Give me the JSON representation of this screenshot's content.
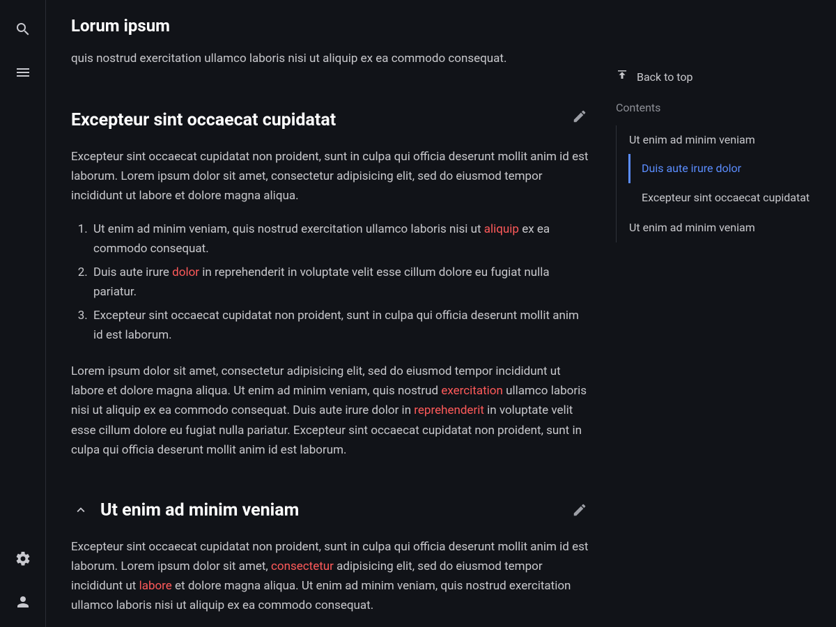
{
  "page": {
    "title": "Lorum ipsum"
  },
  "rail": {
    "search": "Search",
    "menu": "Menu",
    "settings": "Settings",
    "account": "Account"
  },
  "toc": {
    "back": "Back to top",
    "contents": "Contents",
    "items": [
      {
        "label": "Ut enim ad minim veniam",
        "children": [
          {
            "label": "Duis aute irure dolor",
            "active": true
          },
          {
            "label": "Excepteur sint occaecat cupidatat"
          }
        ]
      },
      {
        "label": "Ut enim ad minim veniam"
      }
    ]
  },
  "article": {
    "cutoff_top": "elit, sed do eiusmod tempor incididunt ut labore et dolore magna aliqua. Ut enim ad minim veniam, quis nostrud exercitation ullamco laboris nisi ut aliquip ex ea commodo consequat.",
    "section1": {
      "heading": "Excepteur sint occaecat cupidatat",
      "p1": "Excepteur sint occaecat cupidatat non proident, sunt in culpa qui officia deserunt mollit anim id est laborum. Lorem ipsum dolor sit amet, consectetur adipisicing elit, sed do eiusmod tempor incididunt ut labore et dolore magna aliqua.",
      "list": [
        {
          "pre": "Ut enim ad minim veniam, quis nostrud exercitation ullamco laboris nisi ut ",
          "link": "aliquip",
          "post": " ex ea commodo consequat."
        },
        {
          "pre": "Duis aute irure ",
          "link": "dolor",
          "post": " in reprehenderit in voluptate velit esse cillum dolore eu fugiat nulla pariatur."
        },
        {
          "pre": "Excepteur sint occaecat cupidatat non proident, sunt in culpa qui officia deserunt mollit anim id est laborum.",
          "link": "",
          "post": ""
        }
      ],
      "p2": {
        "a": "Lorem ipsum dolor sit amet, consectetur adipisicing elit, sed do eiusmod tempor incididunt ut labore et dolore magna aliqua. Ut enim ad minim veniam, quis nostrud ",
        "link1": "exercitation",
        "b": " ullamco laboris nisi ut aliquip ex ea commodo consequat. Duis aute irure dolor in ",
        "link2": "reprehenderit",
        "c": " in voluptate velit esse cillum dolore eu fugiat nulla pariatur. Excepteur sint occaecat cupidatat non proident, sunt in culpa qui officia deserunt mollit anim id est laborum."
      }
    },
    "section2": {
      "heading": "Ut enim ad minim veniam",
      "p": {
        "a": "Excepteur sint occaecat cupidatat non proident, sunt in culpa qui officia deserunt mollit anim id est laborum. Lorem ipsum dolor sit amet, ",
        "link1": "consectetur",
        "b": " adipisicing elit, sed do eiusmod tempor incididunt ut ",
        "link2": "labore",
        "c": " et dolore magna aliqua. Ut enim ad minim veniam, quis nostrud exercitation ullamco laboris nisi ut aliquip ex ea commodo consequat."
      }
    }
  }
}
